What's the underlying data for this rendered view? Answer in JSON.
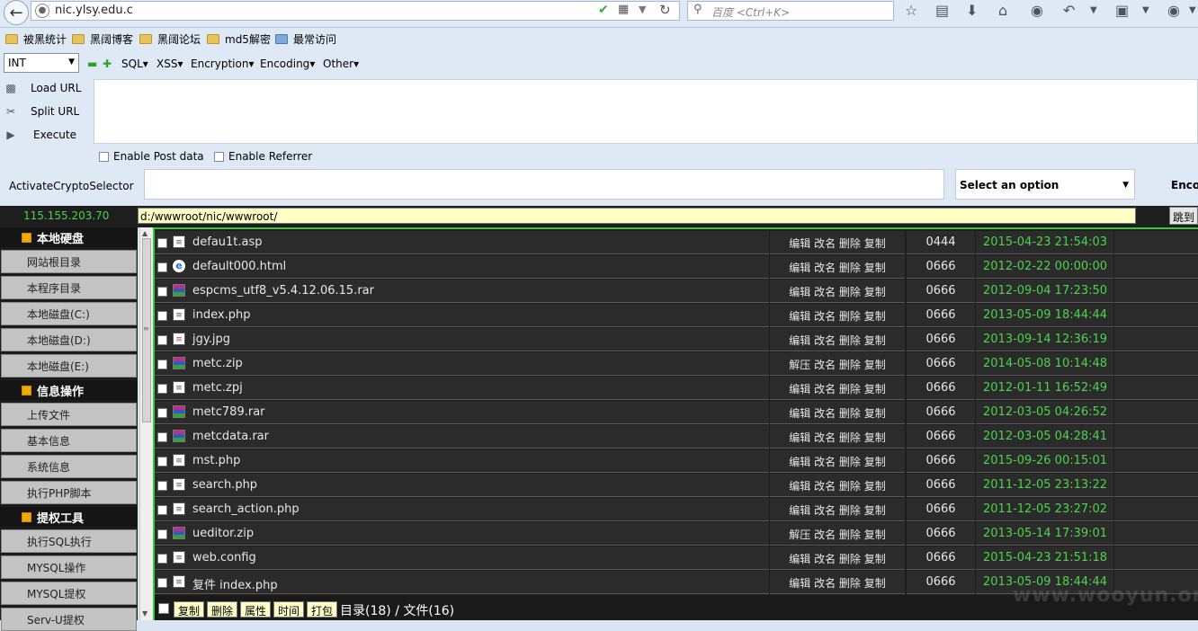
{
  "browser": {
    "url": "nic.ylsy.edu.c",
    "search_placeholder": "百度 <Ctrl+K>"
  },
  "bookmarks": [
    "被黑统计",
    "黑阔博客",
    "黑阔论坛",
    "md5解密",
    "最常访问"
  ],
  "hackbar": {
    "type_select": "INT",
    "menus": [
      "SQL",
      "XSS",
      "Encryption",
      "Encoding",
      "Other"
    ],
    "commands": [
      "Load URL",
      "Split URL",
      "Execute"
    ],
    "enable_post": "Enable Post data",
    "enable_referrer": "Enable Referrer",
    "crypto_label": "ActivateCryptoSelector",
    "select_option": "Select an option",
    "encode_label": "Enco"
  },
  "shell": {
    "ip": "115.155.203.70",
    "path": "d:/wwwroot/nic/wwwroot/",
    "jump_label": "跳到",
    "sidebar": [
      {
        "title": "本地硬盘",
        "items": [
          "网站根目录",
          "本程序目录",
          "本地磁盘(C:)",
          "本地磁盘(D:)",
          "本地磁盘(E:)"
        ]
      },
      {
        "title": "信息操作",
        "items": [
          "上传文件",
          "基本信息",
          "系统信息",
          "执行PHP脚本"
        ]
      },
      {
        "title": "提权工具",
        "items": [
          "执行SQL执行",
          "MYSQL操作",
          "MYSQL提权",
          "Serv-U提权"
        ]
      }
    ],
    "files": [
      {
        "name": "defau1t.asp",
        "icon": "file-icon",
        "ops": "编辑 改名 删除 复制",
        "perm": "0444",
        "mtime": "2015-04-23 21:54:03"
      },
      {
        "name": "default000.html",
        "icon": "html-icon",
        "ops": "编辑 改名 删除 复制",
        "perm": "0666",
        "mtime": "2012-02-22 00:00:00"
      },
      {
        "name": "espcms_utf8_v5.4.12.06.15.rar",
        "icon": "archive-icon",
        "ops": "编辑 改名 删除 复制",
        "perm": "0666",
        "mtime": "2012-09-04 17:23:50"
      },
      {
        "name": "index.php",
        "icon": "file-icon",
        "ops": "编辑 改名 删除 复制",
        "perm": "0666",
        "mtime": "2013-05-09 18:44:44"
      },
      {
        "name": "jgy.jpg",
        "icon": "image-icon",
        "ops": "编辑 改名 删除 复制",
        "perm": "0666",
        "mtime": "2013-09-14 12:36:19"
      },
      {
        "name": "metc.zip",
        "icon": "archive-icon",
        "ops": "解压 改名 删除 复制",
        "perm": "0666",
        "mtime": "2014-05-08 10:14:48"
      },
      {
        "name": "metc.zpj",
        "icon": "file-icon",
        "ops": "编辑 改名 删除 复制",
        "perm": "0666",
        "mtime": "2012-01-11 16:52:49"
      },
      {
        "name": "metc789.rar",
        "icon": "archive-icon",
        "ops": "编辑 改名 删除 复制",
        "perm": "0666",
        "mtime": "2012-03-05 04:26:52"
      },
      {
        "name": "metcdata.rar",
        "icon": "archive-icon",
        "ops": "编辑 改名 删除 复制",
        "perm": "0666",
        "mtime": "2012-03-05 04:28:41"
      },
      {
        "name": "mst.php",
        "icon": "file-icon",
        "ops": "编辑 改名 删除 复制",
        "perm": "0666",
        "mtime": "2015-09-26 00:15:01"
      },
      {
        "name": "search.php",
        "icon": "file-icon",
        "ops": "编辑 改名 删除 复制",
        "perm": "0666",
        "mtime": "2011-12-05 23:13:22"
      },
      {
        "name": "search_action.php",
        "icon": "file-icon",
        "ops": "编辑 改名 删除 复制",
        "perm": "0666",
        "mtime": "2011-12-05 23:27:02"
      },
      {
        "name": "ueditor.zip",
        "icon": "archive-icon",
        "ops": "解压 改名 删除 复制",
        "perm": "0666",
        "mtime": "2013-05-14 17:39:01"
      },
      {
        "name": "web.config",
        "icon": "file-icon",
        "ops": "编辑 改名 删除 复制",
        "perm": "0666",
        "mtime": "2015-04-23 21:51:18"
      },
      {
        "name": "复件 index.php",
        "icon": "file-icon",
        "ops": "编辑 改名 删除 复制",
        "perm": "0666",
        "mtime": "2013-05-09 18:44:44"
      }
    ],
    "bottom_buttons": [
      "复制",
      "删除",
      "属性",
      "时间",
      "打包"
    ],
    "summary": "目录(18) / 文件(16)"
  },
  "watermark": "www.wooyun.org"
}
